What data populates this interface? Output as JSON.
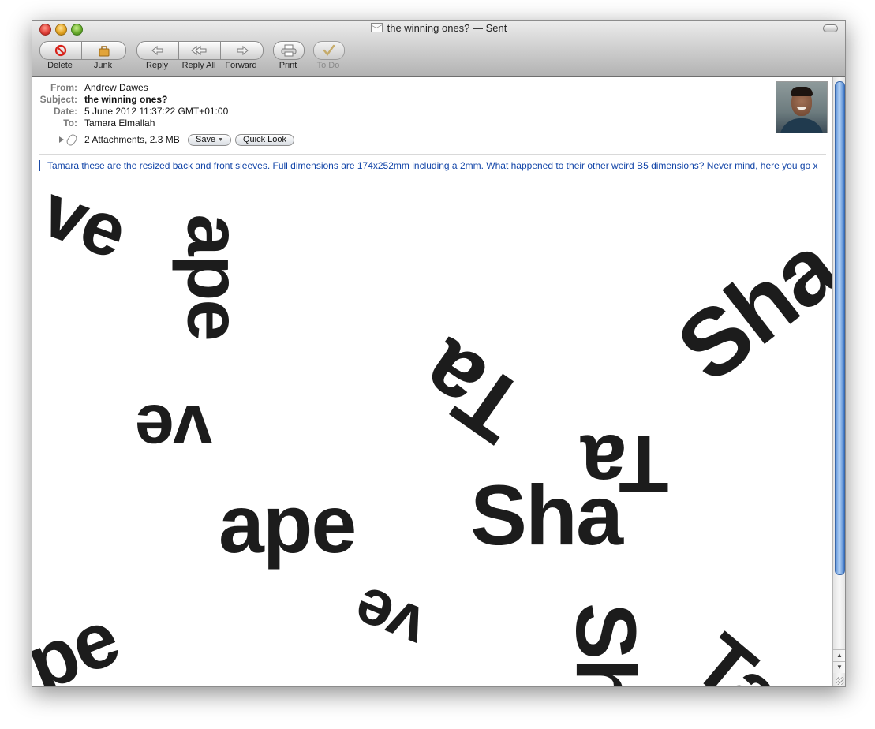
{
  "window": {
    "title": "the winning ones? — Sent",
    "title_icon": "envelope-icon"
  },
  "toolbar": {
    "delete": {
      "label": "Delete",
      "icon": "delete-icon"
    },
    "junk": {
      "label": "Junk",
      "icon": "junk-icon"
    },
    "reply": {
      "label": "Reply",
      "icon": "reply-icon"
    },
    "reply_all": {
      "label": "Reply All",
      "icon": "reply-all-icon"
    },
    "forward": {
      "label": "Forward",
      "icon": "forward-icon"
    },
    "print": {
      "label": "Print",
      "icon": "print-icon"
    },
    "todo": {
      "label": "To Do",
      "icon": "todo-icon",
      "enabled": false
    }
  },
  "headers": {
    "from_label": "From:",
    "from": "Andrew Dawes",
    "subject_label": "Subject:",
    "subject": "the winning ones?",
    "date_label": "Date:",
    "date": "5 June 2012 11:37:22 GMT+01:00",
    "to_label": "To:",
    "to": "Tamara Elmallah"
  },
  "attachments": {
    "summary": "2 Attachments, 2.3 MB",
    "save_label": "Save",
    "quicklook_label": "Quick Look"
  },
  "body": {
    "text": "Tamara these are the resized back and front sleeves. Full dimensions are 174x252mm including a 2mm. What happened to their other weird B5 dimensions? Never mind, here you go x"
  },
  "attachment_image": {
    "words": [
      "ve",
      "ape",
      "ve",
      "Ta",
      "Sha",
      "Ta",
      "ape",
      "Sha",
      "pe",
      "ve",
      "Sh",
      "Ta"
    ]
  },
  "colors": {
    "quote_text": "#1245a8",
    "quote_bar": "#1a4aa8",
    "scroll_thumb": "#5a8fd6",
    "art_ink": "#1c1c1c"
  }
}
